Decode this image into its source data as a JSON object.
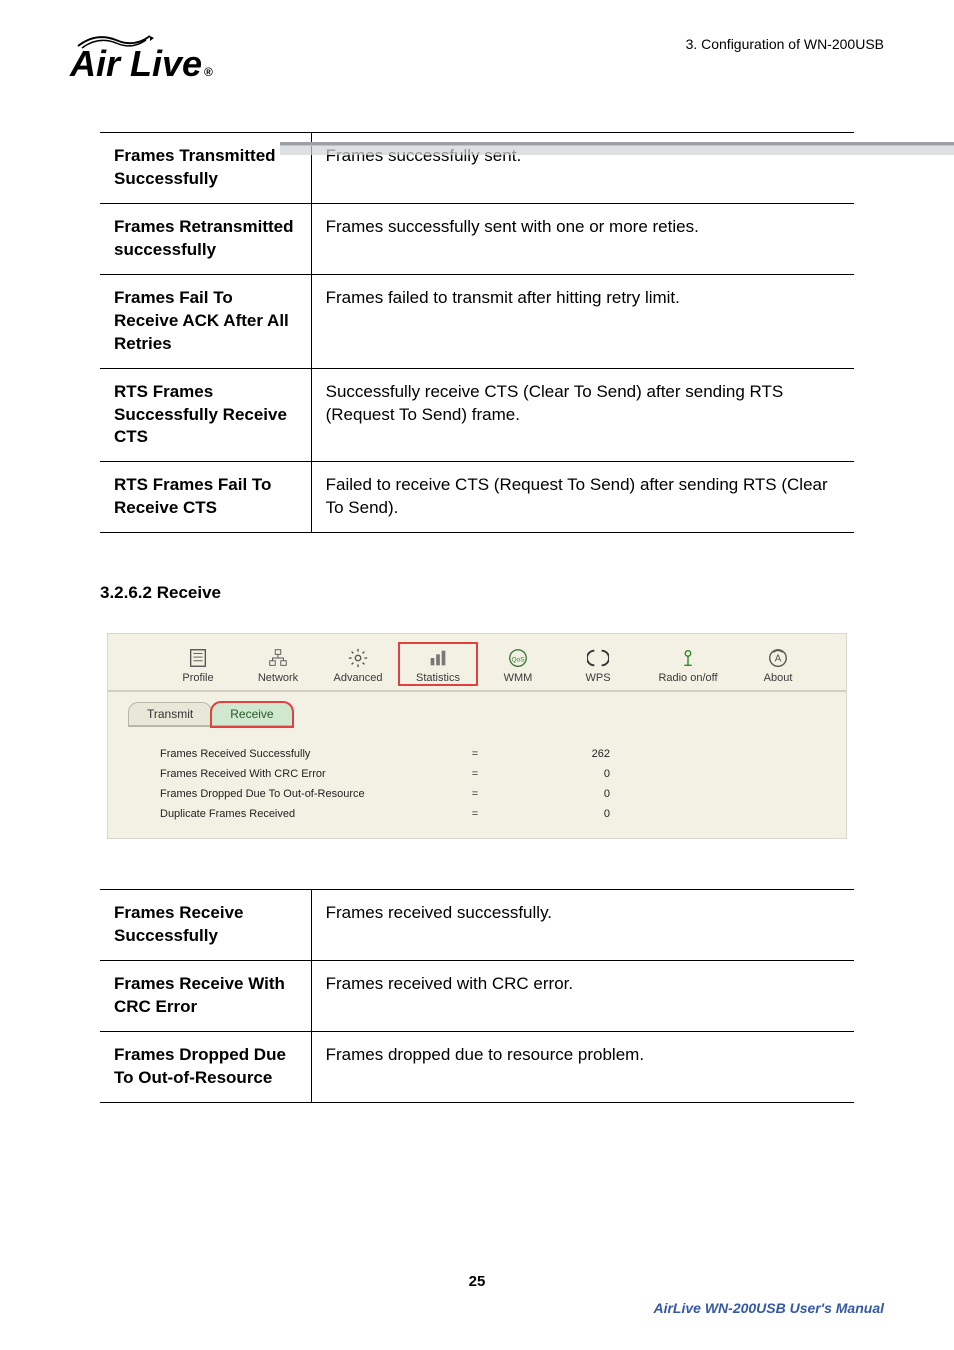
{
  "header": {
    "chapter": "3.  Configuration  of  WN-200USB",
    "logo_text": "Air Live",
    "logo_reg": "®"
  },
  "transmit_table": [
    {
      "term": "Frames Transmitted Successfully",
      "desc": "Frames successfully sent."
    },
    {
      "term": "Frames Retransmitted successfully",
      "desc": "Frames successfully sent with one or more reties."
    },
    {
      "term": "Frames Fail To Receive ACK After All Retries",
      "desc": "Frames failed to transmit after hitting retry limit."
    },
    {
      "term": "RTS Frames Successfully Receive CTS",
      "desc": "Successfully receive CTS (Clear To Send) after sending RTS (Request To Send) frame."
    },
    {
      "term": "RTS Frames Fail To Receive CTS",
      "desc": "Failed to receive CTS (Request To Send) after sending RTS (Clear To Send)."
    }
  ],
  "section_heading": "3.2.6.2 Receive",
  "screenshot": {
    "toolbar": [
      {
        "label": "Profile"
      },
      {
        "label": "Network"
      },
      {
        "label": "Advanced"
      },
      {
        "label": "Statistics"
      },
      {
        "label": "WMM"
      },
      {
        "label": "WPS"
      },
      {
        "label": "Radio on/off"
      },
      {
        "label": "About"
      }
    ],
    "subtabs": {
      "transmit": "Transmit",
      "receive": "Receive"
    },
    "stats": [
      {
        "label": "Frames Received Successfully",
        "value": "262"
      },
      {
        "label": "Frames Received With CRC Error",
        "value": "0"
      },
      {
        "label": "Frames Dropped Due To Out-of-Resource",
        "value": "0"
      },
      {
        "label": "Duplicate Frames Received",
        "value": "0"
      }
    ]
  },
  "receive_table": [
    {
      "term": "Frames Receive Successfully",
      "desc": "Frames received successfully."
    },
    {
      "term": "Frames Receive With CRC Error",
      "desc": "Frames received with CRC error."
    },
    {
      "term": "Frames Dropped Due To Out-of-Resource",
      "desc": "Frames dropped due to resource problem."
    }
  ],
  "page_number": "25",
  "footer": "AirLive  WN-200USB  User's  Manual"
}
